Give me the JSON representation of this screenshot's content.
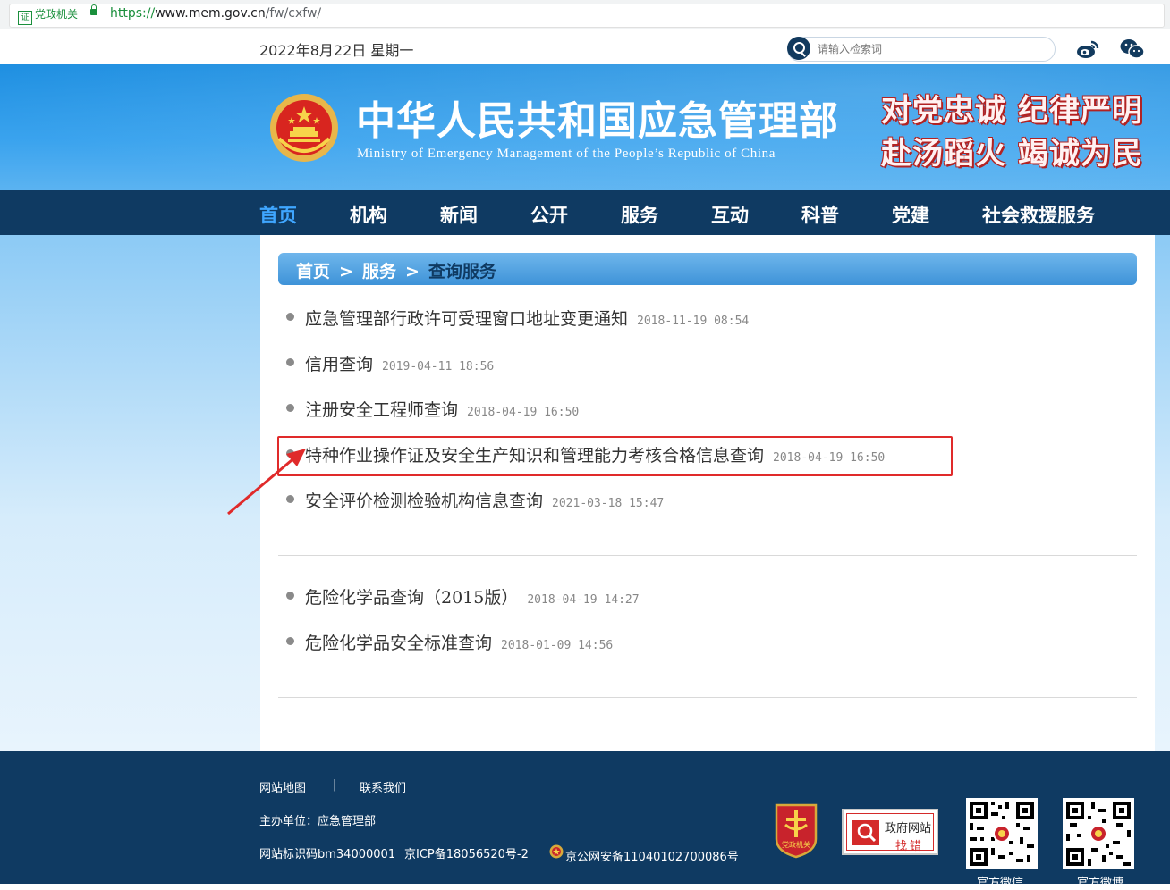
{
  "browser": {
    "badge": "党政机关",
    "badge_mark": "证",
    "url_proto": "https://",
    "url_host": "www.mem.gov.cn",
    "url_path": "/fw/cxfw/"
  },
  "topbar": {
    "date": "2022年8月22日 星期一",
    "search_placeholder": "请输入检索词"
  },
  "header": {
    "title_cn": "中华人民共和国应急管理部",
    "title_en": "Ministry of Emergency Management of the People’s Republic of China",
    "slogan_line1": "对党忠诚 纪律严明",
    "slogan_line2": "赴汤蹈火 竭诚为民"
  },
  "nav": {
    "items": [
      {
        "label": "首页"
      },
      {
        "label": "机构"
      },
      {
        "label": "新闻"
      },
      {
        "label": "公开"
      },
      {
        "label": "服务"
      },
      {
        "label": "互动"
      },
      {
        "label": "科普"
      },
      {
        "label": "党建"
      },
      {
        "label": "社会救援服务"
      }
    ]
  },
  "breadcrumb": {
    "home": "首页",
    "sep": ">",
    "section": "服务",
    "current": "查询服务"
  },
  "list1": [
    {
      "title": "应急管理部行政许可受理窗口地址变更通知",
      "date": "2018-11-19 08:54"
    },
    {
      "title": "信用查询",
      "date": "2019-04-11 18:56"
    },
    {
      "title": "注册安全工程师查询",
      "date": "2018-04-19 16:50"
    },
    {
      "title": "特种作业操作证及安全生产知识和管理能力考核合格信息查询",
      "date": "2018-04-19 16:50"
    },
    {
      "title": "安全评价检测检验机构信息查询",
      "date": "2021-03-18 15:47"
    }
  ],
  "list2": [
    {
      "title": "危险化学品查询（2015版）",
      "date": "2018-04-19 14:27"
    },
    {
      "title": "危险化学品安全标准查询",
      "date": "2018-01-09 14:56"
    }
  ],
  "footer": {
    "sitemap": "网站地图",
    "divider": "|",
    "contact": "联系我们",
    "sponsor": "主办单位：应急管理部",
    "site_id": "网站标识码bm34000001",
    "icp": "京ICP备18056520号-2",
    "police": "京公网安备11040102700086号",
    "party_logo_text": "党政机关",
    "gov_error_line1": "政府网站",
    "gov_error_line2": "找错",
    "qr1_label": "官方微信",
    "qr2_label": "官方微博"
  },
  "colors": {
    "nav_bg": "#0f3a62",
    "nav_active": "#3fa6ff",
    "banner": "#2f9be8",
    "highlight": "#e02a2a"
  }
}
